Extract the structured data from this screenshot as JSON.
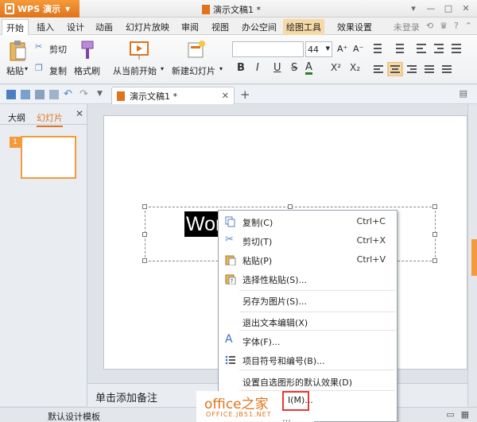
{
  "title_bar": {
    "app_name": "WPS 演示",
    "document_title": "演示文稿1 *"
  },
  "menu": {
    "tabs": [
      "开始",
      "插入",
      "设计",
      "动画",
      "幻灯片放映",
      "审阅",
      "视图",
      "办公空间",
      "绘图工具",
      "效果设置"
    ],
    "active_tab": "开始",
    "login_label": "未登录"
  },
  "ribbon": {
    "paste_label": "粘贴",
    "cut_label": "剪切",
    "copy_label": "复制",
    "format_painter_label": "格式刷",
    "from_current_label": "从当前开始",
    "new_slide_label": "新建幻灯片",
    "font_size": "44",
    "bold": "B",
    "italic": "I",
    "underline": "U",
    "strike": "S",
    "font_color": "A",
    "superscript": "X²",
    "subscript": "X₂"
  },
  "doc_tab": {
    "label": "演示文稿1 *"
  },
  "left_pane": {
    "outline_tab": "大纲",
    "slides_tab": "幻灯片",
    "slide_number": "1"
  },
  "slide": {
    "selected_text": "Word"
  },
  "notes_placeholder": "单击添加备注",
  "status_bar": {
    "template": "默认设计模板"
  },
  "context_menu": {
    "items": [
      {
        "label": "复制(C)",
        "shortcut": "Ctrl+C",
        "icon": "copy-icon"
      },
      {
        "label": "剪切(T)",
        "shortcut": "Ctrl+X",
        "icon": "scissors-icon"
      },
      {
        "label": "粘贴(P)",
        "shortcut": "Ctrl+V",
        "icon": "paste-icon"
      },
      {
        "label": "选择性粘贴(S)...",
        "shortcut": "",
        "icon": "paste-special-icon"
      },
      {
        "label": "另存为图片(S)...",
        "shortcut": "",
        "icon": ""
      },
      {
        "label": "退出文本编辑(X)",
        "shortcut": "",
        "icon": ""
      },
      {
        "label": "字体(F)...",
        "shortcut": "",
        "icon": "font-icon"
      },
      {
        "label": "项目符号和编号(B)...",
        "shortcut": "",
        "icon": "bullets-icon"
      },
      {
        "label": "设置自选图形的默认效果(D)",
        "shortcut": "",
        "icon": ""
      },
      {
        "label": "I(M)...",
        "shortcut": "",
        "icon": ""
      }
    ]
  },
  "watermark": {
    "logo": "office之家",
    "url": "OFFICE.JB51.NET"
  },
  "colors": {
    "accent": "#e0731b",
    "selection": "#000000",
    "highlight_box": "#e53935"
  }
}
